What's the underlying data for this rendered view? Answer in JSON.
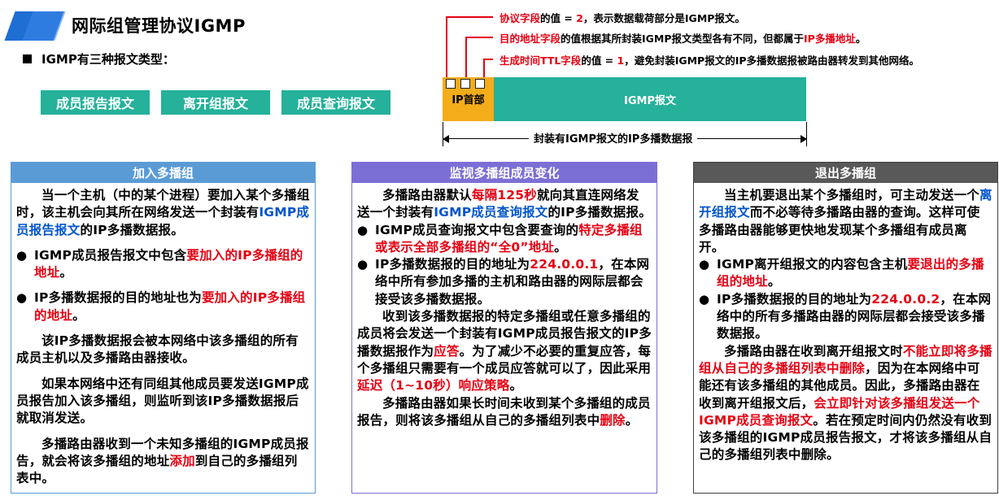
{
  "header": {
    "title": "网际组管理协议IGMP",
    "subtitle": "IGMP有三种报文类型："
  },
  "message_types": [
    "成员报告报文",
    "离开组报文",
    "成员查询报文"
  ],
  "diagram": {
    "ann1": {
      "field": "协议字段",
      "mid": "的值 = ",
      "value": "2",
      "rest": "，表示数据载荷部分是IGMP报文。"
    },
    "ann2": {
      "field": "目的地址字段",
      "mid": "的值根据其所封装IGMP报文类型各有不同，但都属于",
      "value": "IP多播地址",
      "rest": "。"
    },
    "ann3": {
      "field": "生成时间TTL字段",
      "mid": "的值 = ",
      "value": "1",
      "rest": "，避免封装IGMP报文的IP多播数据报被路由器转发到其他网络。"
    },
    "ip_header_label": "IP首部",
    "igmp_label": "IGMP报文",
    "encapsulated_label": "封装有IGMP报文的IP多播数据报"
  },
  "panels": {
    "join": {
      "title": "加入多播组",
      "p1a": "当一个主机（中的某个进程）要加入某个多播组时，该主机会向其所在网络发送一个封装有",
      "p1b": "IGMP成员报告报文",
      "p1c": "的IP多播数据报。",
      "b1a": "IGMP成员报告报文中包含",
      "b1b": "要加入的IP多播组的地址",
      "b1c": "。",
      "b2a": "IP多播数据报的目的地址也为",
      "b2b": "要加入的IP多播组的地址",
      "b2c": "。",
      "p2": "该IP多播数据报会被本网络中该多播组的所有成员主机以及多播路由器接收。",
      "p3": "如果本网络中还有同组其他成员要发送IGMP成员报告加入该多播组，则监听到该IP多播数据报后就取消发送。",
      "p4a": "多播路由器收到一个未知多播组的IGMP成员报告，就会将该多播组的地址",
      "p4b": "添加",
      "p4c": "到自己的多播组列表中。"
    },
    "monitor": {
      "title": "监视多播组成员变化",
      "p1a": "多播路由器默认",
      "p1b": "每隔125秒",
      "p1c": "就向其直连网络发送一个封装有",
      "p1d": "IGMP成员查询报文",
      "p1e": "的IP多播数据报。",
      "b1a": "IGMP成员查询报文中包含要查询的",
      "b1b": "特定多播组或表示全部多播组的“全0”地址",
      "b1c": "。",
      "b2a": "IP多播数据报的目的地址为",
      "b2b": "224.0.0.1",
      "b2c": "，在本网络中所有参加多播的主机和路由器的网际层都会接受该多播数据报。",
      "p2a": "收到该多播数据报的特定多播组或任意多播组的成员将会发送一个封装有IGMP成员报告报文的IP多播数据报作为",
      "p2b": "应答",
      "p2c": "。为了减少不必要的重复应答，每个多播组只需要有一个成员应答就可以了，因此采用",
      "p2d": "延迟（1~10秒）响应策略",
      "p2e": "。",
      "p3a": "多播路由器如果长时间未收到某个多播组的成员报告，则将该多播组从自己的多播组列表中",
      "p3b": "删除",
      "p3c": "。"
    },
    "leave": {
      "title": "退出多播组",
      "p1a": "当主机要退出某个多播组时，可主动发送一个",
      "p1b": "离开组报文",
      "p1c": "而不必等待多播路由器的查询。这样可使多播路由器能够更快地发现某个多播组有成员离开。",
      "b1a": "IGMP离开组报文的内容包含主机",
      "b1b": "要退出的多播组的地址",
      "b1c": "。",
      "b2a": "IP多播数据报的目的地址为",
      "b2b": "224.0.0.2",
      "b2c": "，在本网络中的所有多播路由器的网际层都会接受该多播数据报。",
      "p2a": "多播路由器在收到离开组报文时",
      "p2b": "不能立即将多播组从自己的多播组列表中删除",
      "p2c": "，因为在本网络中可能还有该多播组的其他成员。因此，多播路由器在收到离开组报文后，",
      "p2d": "会立即针对该多播组发送一个IGMP成员查询报文",
      "p2e": "。若在预定时间内仍然没有收到该多播组的IGMP成员报告报文，才将该多播组从自己的多播组列表中删除。"
    }
  },
  "colors": {
    "teal": "#25b19a",
    "orange": "#f3ac1a",
    "red": "#e60012",
    "blue": "#0055cc",
    "join_border": "#5b9bd5",
    "join_head": "#5b9bd5",
    "monitor_border": "#7b6fd6",
    "monitor_head": "#7b6fd6",
    "leave_border": "#3f3f3f",
    "leave_head": "#595959"
  }
}
